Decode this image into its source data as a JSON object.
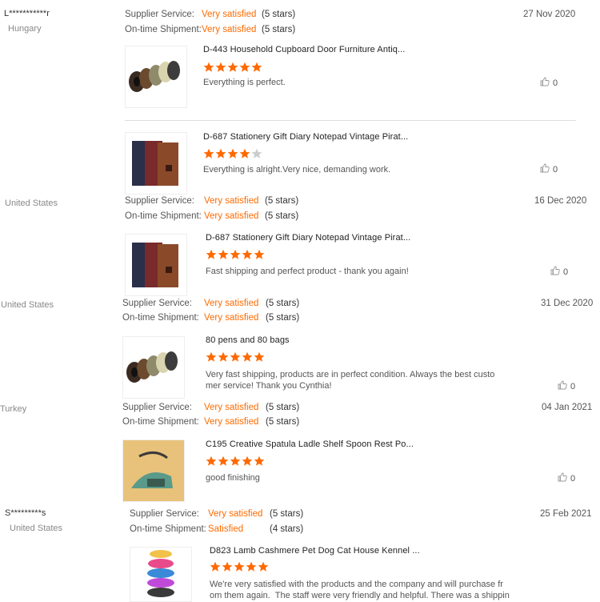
{
  "labels": {
    "supplier": "Supplier Service:",
    "shipment": "On-time Shipment:"
  },
  "colors": {
    "accent": "#ff6a00",
    "star_off": "#cccccc"
  },
  "reviews": [
    {
      "buyer": "L***********r",
      "country": "Hungary",
      "supplier_rating": "Very satisfied",
      "supplier_stars": "(5 stars)",
      "shipment_rating": "Very satisfied",
      "shipment_stars": "(5 stars)",
      "date": "27 Nov 2020",
      "items": [
        {
          "title": "D-443 Household Cupboard Door Furniture Antiq...",
          "stars": 5,
          "text": "Everything is perfect.",
          "likes": "0",
          "image": "rings"
        },
        {
          "title": "D-687 Stationery Gift Diary Notepad Vintage Pirat...",
          "stars": 4,
          "text": "Everything is alright.Very nice, demanding work.",
          "likes": "0",
          "image": "diary"
        }
      ]
    },
    {
      "buyer": "",
      "country": "United States",
      "supplier_rating": "Very satisfied",
      "supplier_stars": "(5 stars)",
      "shipment_rating": "Very satisfied",
      "shipment_stars": "(5 stars)",
      "date": "16 Dec 2020",
      "items": [
        {
          "title": "D-687 Stationery Gift Diary Notepad Vintage Pirat...",
          "stars": 5,
          "text": "Fast shipping and perfect product - thank you again!",
          "likes": "0",
          "image": "diary"
        }
      ]
    },
    {
      "buyer": "",
      "country": "United States",
      "supplier_rating": "Very satisfied",
      "supplier_stars": "(5 stars)",
      "shipment_rating": "Very satisfied",
      "shipment_stars": "(5 stars)",
      "date": "31 Dec 2020",
      "items": [
        {
          "title": "80 pens and 80 bags",
          "stars": 5,
          "text": "Very fast shipping, products are in perfect condition. Always the best custo\nmer service! Thank you Cynthia!",
          "likes": "0",
          "image": "rings"
        }
      ]
    },
    {
      "buyer": "",
      "country": "Turkey",
      "supplier_rating": "Very satisfied",
      "supplier_stars": "(5 stars)",
      "shipment_rating": "Very satisfied",
      "shipment_stars": "(5 stars)",
      "date": "04 Jan 2021",
      "items": [
        {
          "title": "C195 Creative Spatula Ladle Shelf Spoon Rest Po...",
          "stars": 5,
          "text": "good finishing",
          "likes": "0",
          "image": "spatula"
        }
      ]
    },
    {
      "buyer": "S*********s",
      "country": "United States",
      "supplier_rating": "Very satisfied",
      "supplier_stars": "(5 stars)",
      "shipment_rating": "Satisfied",
      "shipment_stars": "(4 stars)",
      "date": "25 Feb 2021",
      "items": [
        {
          "title": "D823 Lamb Cashmere Pet Dog Cat House Kennel ...",
          "stars": 5,
          "text": "We're very satisfied with the products and the company and will purchase fr\nom them again.  The staff were very friendly and helpful. There was a shippin",
          "likes": "",
          "image": "petbed"
        }
      ]
    }
  ]
}
